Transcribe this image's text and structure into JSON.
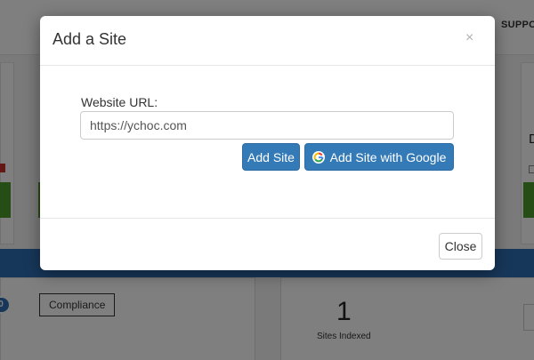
{
  "background": {
    "support_label": "SUPPO",
    "partial_letter": "D",
    "badge_value": "0",
    "compliance_label": "Compliance",
    "sites_indexed_count": "1",
    "sites_indexed_label": "Sites Indexed"
  },
  "modal": {
    "title": "Add a Site",
    "close_icon": "×",
    "field_label": "Website URL:",
    "url_value": "https://ychoc.com",
    "add_site_label": "Add Site",
    "add_google_label": "Add Site with Google",
    "google_icon": "google-icon",
    "close_button_label": "Close"
  },
  "colors": {
    "primary": "#337ab7",
    "backdrop": "rgba(0,0,0,0.5)",
    "green": "#4a9a2a",
    "bar_blue": "#2f6eb5"
  }
}
